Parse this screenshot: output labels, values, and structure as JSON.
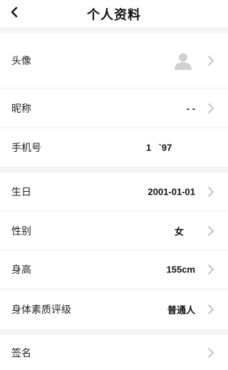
{
  "header": {
    "title": "个人资料",
    "back_icon": "chevron-left-icon"
  },
  "account": {
    "avatar_label": "头像",
    "avatar_icon": "user-placeholder-icon",
    "nickname_label": "昵称",
    "nickname_value": "- -",
    "phone_label": "手机号",
    "phone_value": "1    `97 "
  },
  "body_info": {
    "birthday_label": "生日",
    "birthday_value": "2001-01-01",
    "gender_label": "性别",
    "gender_value": "女",
    "height_label": "身高",
    "height_value": "155cm",
    "fitness_label": "身体素质评级",
    "fitness_value": "普通人"
  },
  "signature": {
    "label": "签名",
    "value": ""
  },
  "colors": {
    "background": "#f4f4f6",
    "card": "#ffffff",
    "chevron": "#b8b8b8",
    "avatar": "#d0d0d3"
  }
}
